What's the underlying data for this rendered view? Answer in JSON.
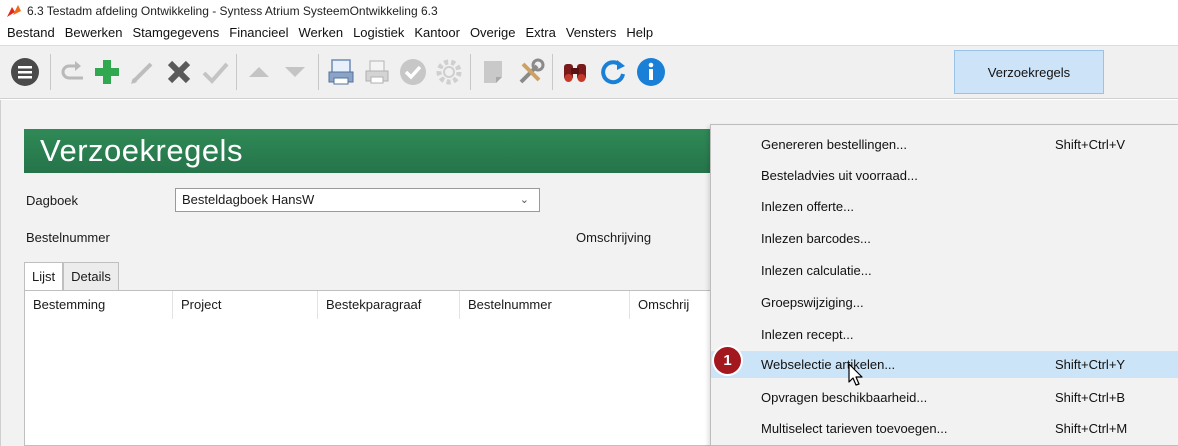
{
  "window": {
    "title": "6.3 Testadm afdeling Ontwikkeling - Syntess Atrium SysteemOntwikkeling 6.3"
  },
  "menubar": {
    "items": [
      "Bestand",
      "Bewerken",
      "Stamgegevens",
      "Financieel",
      "Werken",
      "Logistiek",
      "Kantoor",
      "Overige",
      "Extra",
      "Vensters",
      "Help"
    ]
  },
  "toolbar": {
    "icons": [
      "hamburger-menu-icon",
      "undo-icon",
      "add-icon",
      "edit-icon",
      "delete-icon",
      "confirm-icon",
      "move-up-icon",
      "move-down-icon",
      "print-preview-icon",
      "print-icon",
      "check-circle-icon",
      "settings-gear-icon",
      "document-icon",
      "tools-icon",
      "binoculars-icon",
      "refresh-icon",
      "info-icon"
    ],
    "active_tab": "Verzoekregels"
  },
  "page": {
    "title": "Verzoekregels"
  },
  "form": {
    "dagboek_label": "Dagboek",
    "dagboek_value": "Besteldagboek HansW",
    "bestelnummer_label": "Bestelnummer",
    "omschrijving_label": "Omschrijving"
  },
  "tabs": [
    "Lijst",
    "Details"
  ],
  "grid": {
    "columns": [
      "Bestemming",
      "Project",
      "Bestekparagraaf",
      "Bestelnummer",
      "Omschrij"
    ]
  },
  "context_menu": {
    "items": [
      {
        "label": "Genereren bestellingen...",
        "shortcut": "Shift+Ctrl+V"
      },
      {
        "label": "Besteladvies uit voorraad...",
        "shortcut": ""
      },
      {
        "label": "Inlezen offerte...",
        "shortcut": ""
      },
      {
        "label": "Inlezen barcodes...",
        "shortcut": ""
      },
      {
        "label": "Inlezen calculatie...",
        "shortcut": ""
      },
      {
        "label": "Groepswijziging...",
        "shortcut": ""
      },
      {
        "label": "Inlezen recept...",
        "shortcut": ""
      },
      {
        "label": "Webselectie artikelen...",
        "shortcut": "Shift+Ctrl+Y"
      },
      {
        "label": "Opvragen beschikbaarheid...",
        "shortcut": "Shift+Ctrl+B"
      },
      {
        "label": "Multiselect tarieven toevoegen...",
        "shortcut": "Shift+Ctrl+M"
      }
    ],
    "highlighted_index": 7
  },
  "annotation": {
    "step_number": "1"
  },
  "colors": {
    "banner_green": "#2f8a56",
    "highlight_blue": "#cce4f7",
    "badge_red": "#a3171f",
    "add_green": "#2fa84f",
    "delete_gray": "#5a5a5a",
    "info_blue": "#1a7fd6"
  }
}
